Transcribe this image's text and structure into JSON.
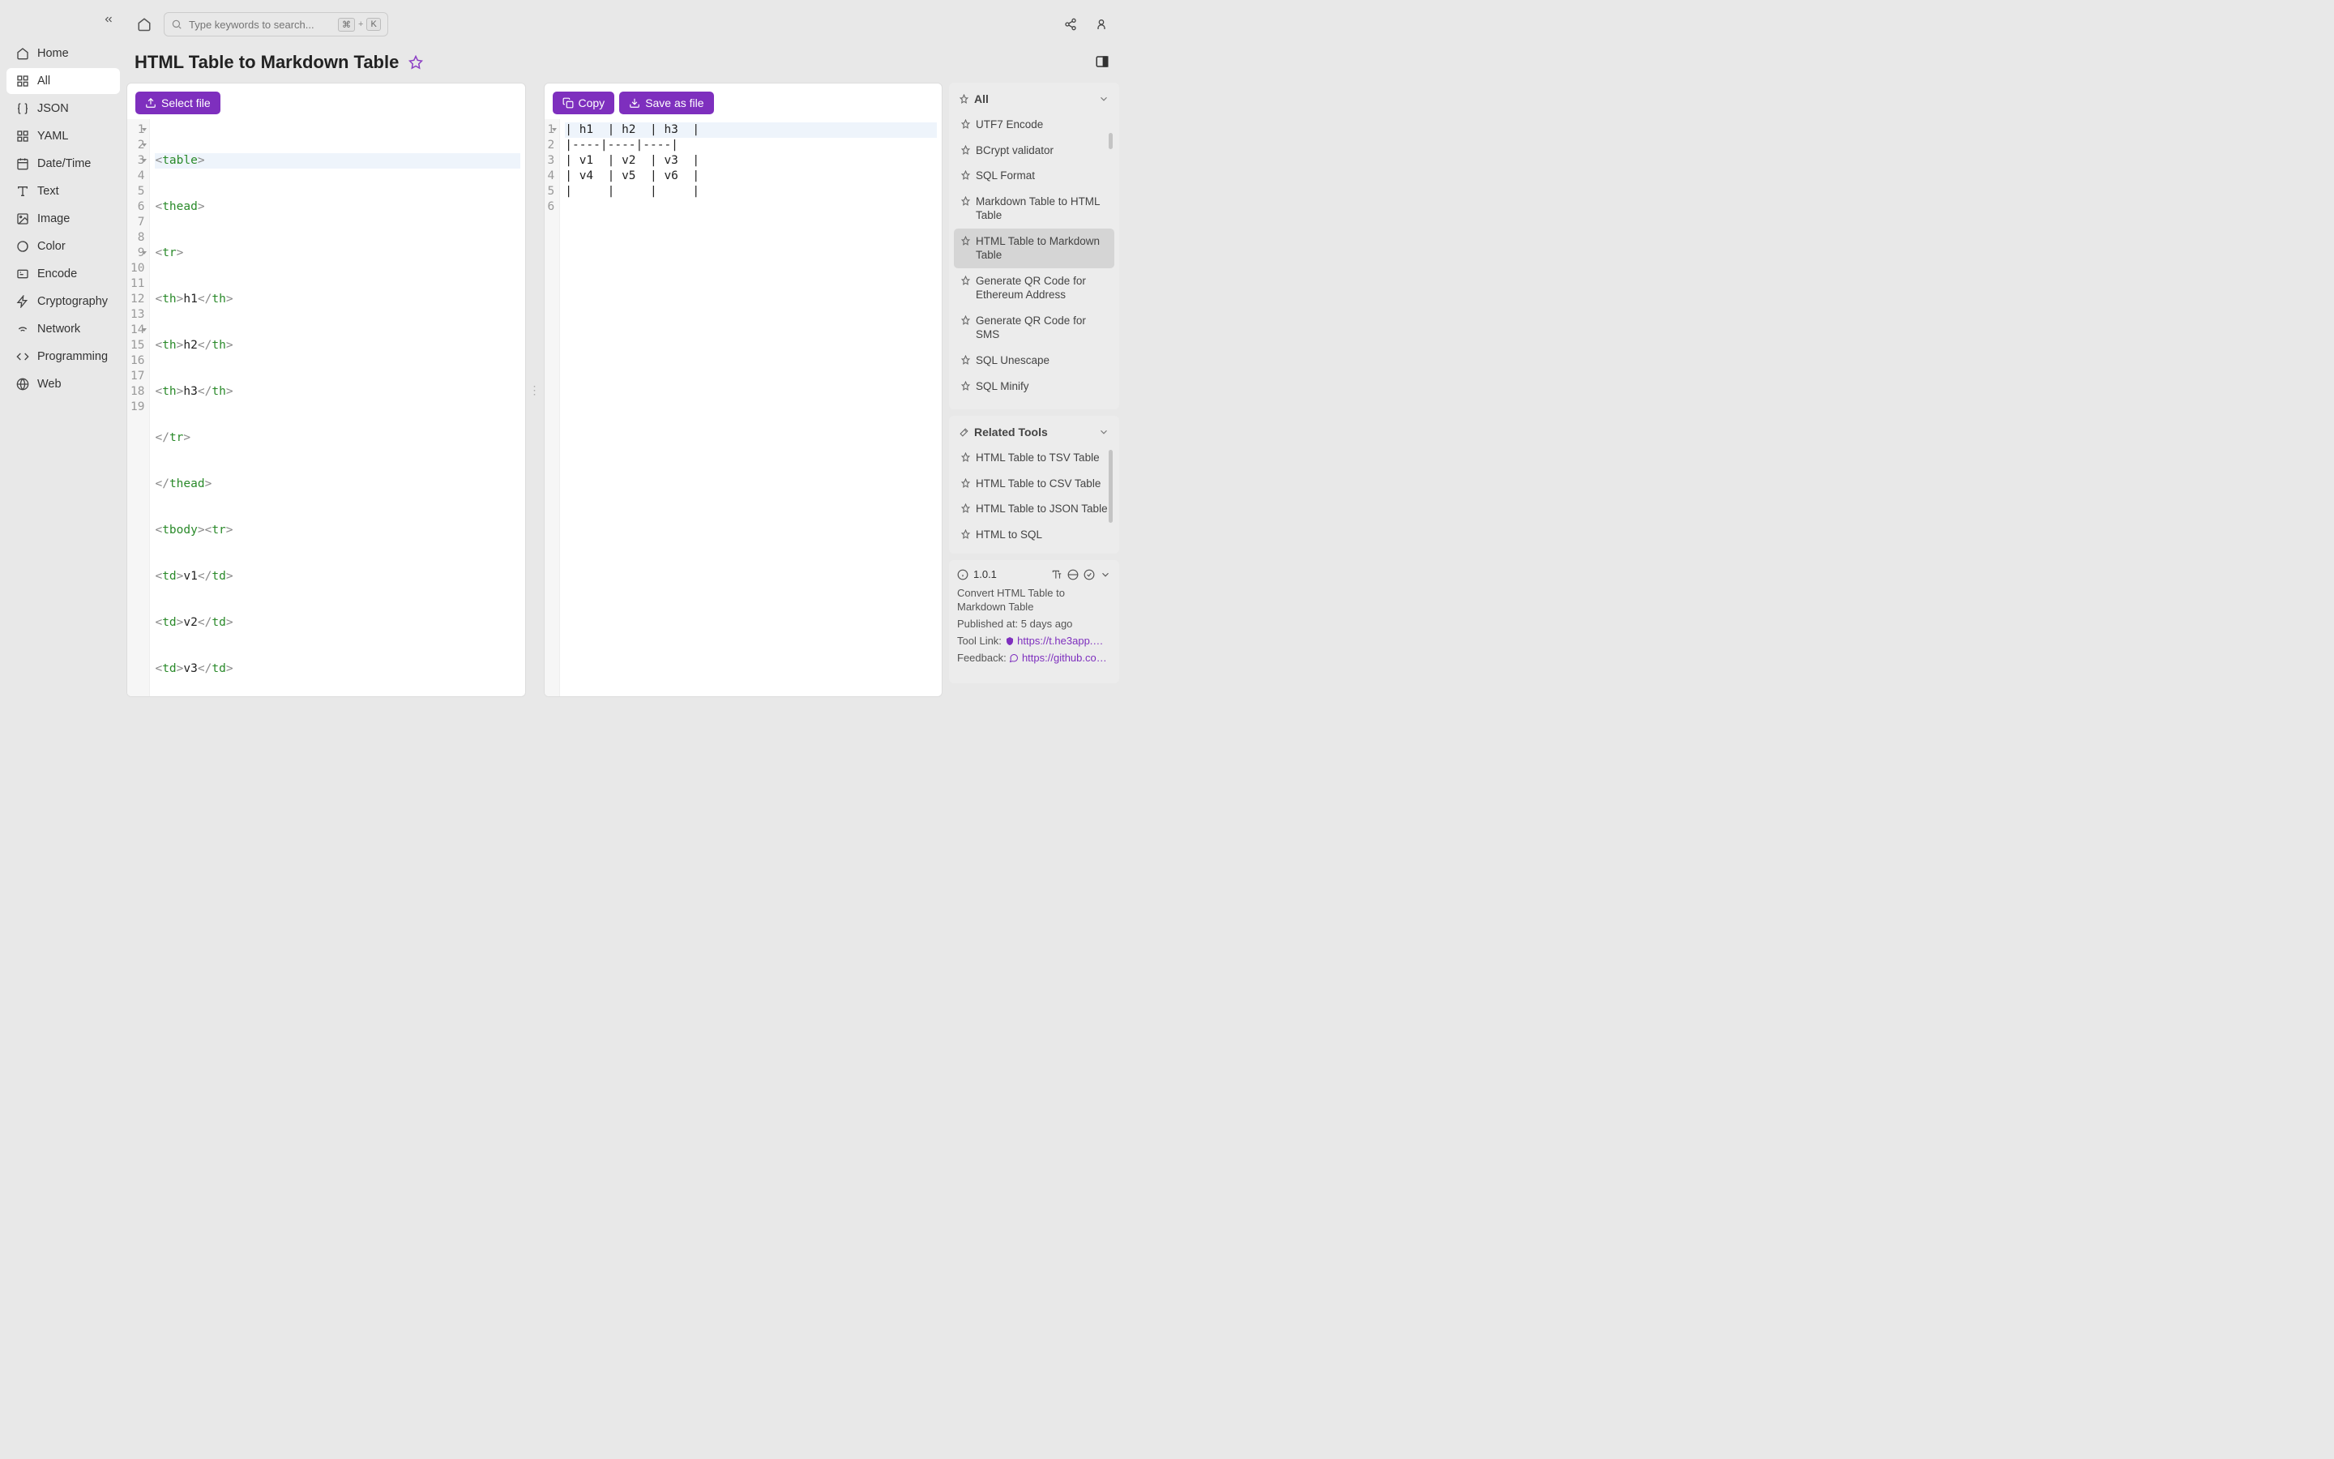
{
  "sidebar": {
    "items": [
      {
        "label": "Home"
      },
      {
        "label": "All"
      },
      {
        "label": "JSON"
      },
      {
        "label": "YAML"
      },
      {
        "label": "Date/Time"
      },
      {
        "label": "Text"
      },
      {
        "label": "Image"
      },
      {
        "label": "Color"
      },
      {
        "label": "Encode"
      },
      {
        "label": "Cryptography"
      },
      {
        "label": "Network"
      },
      {
        "label": "Programming"
      },
      {
        "label": "Web"
      }
    ]
  },
  "search": {
    "placeholder": "Type keywords to search...",
    "cmd_key": "⌘",
    "plus": "+",
    "k_key": "K"
  },
  "page": {
    "title": "HTML Table to Markdown Table"
  },
  "buttons": {
    "select_file": "Select file",
    "copy": "Copy",
    "save_as_file": "Save as file"
  },
  "editor_left": {
    "lines": [
      "1",
      "2",
      "3",
      "4",
      "5",
      "6",
      "7",
      "8",
      "9",
      "10",
      "11",
      "12",
      "13",
      "14",
      "15",
      "16",
      "17",
      "18",
      "19"
    ],
    "folds": [
      1,
      2,
      3,
      9,
      14
    ]
  },
  "editor_right": {
    "lines": [
      "1",
      "2",
      "3",
      "4",
      "5",
      "6"
    ],
    "rows": [
      "| h1  | h2  | h3  |",
      "|----|----|----|",
      "| v1  | v2  | v3  |",
      "| v4  | v5  | v6  |",
      "|     |     |     |",
      ""
    ]
  },
  "right": {
    "all_header": "All",
    "related_header": "Related Tools",
    "all_items": [
      "UTF7 Encode",
      "BCrypt validator",
      "SQL Format",
      "Markdown Table to HTML Table",
      "HTML Table to Markdown Table",
      "Generate QR Code for Ethereum Address",
      "Generate QR Code for SMS",
      "SQL Unescape",
      "SQL Minify"
    ],
    "related_items": [
      "HTML Table to TSV Table",
      "HTML Table to CSV Table",
      "HTML Table to JSON Table",
      "HTML to SQL"
    ]
  },
  "info": {
    "version": "1.0.1",
    "description": "Convert HTML Table to Markdown Table",
    "published_label": "Published at:",
    "published_value": "5 days ago",
    "tool_link_label": "Tool Link:",
    "tool_link_value": "https://t.he3app.co…",
    "feedback_label": "Feedback:",
    "feedback_value": "https://github.com/…"
  },
  "colors": {
    "accent": "#7e2fbe"
  }
}
